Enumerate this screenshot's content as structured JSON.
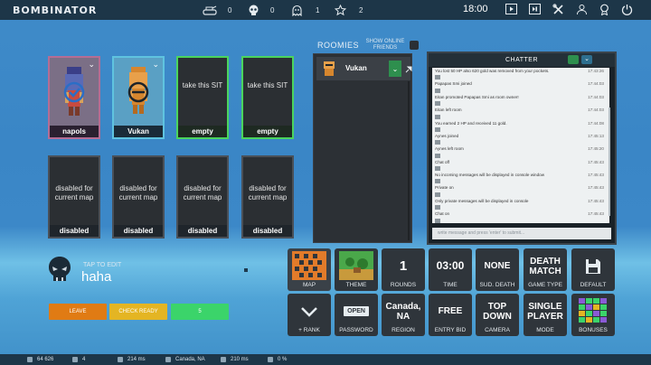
{
  "topbar": {
    "logo": "BOMBINATOR",
    "stats": [
      {
        "icon": "tank-icon",
        "value": "0"
      },
      {
        "icon": "skull-icon",
        "value": "0"
      },
      {
        "icon": "ghost-icon",
        "value": "1"
      },
      {
        "icon": "star-icon",
        "value": "2"
      }
    ],
    "time": "18:00",
    "buttons": [
      "video-icon",
      "replay-icon",
      "tools-icon",
      "users-icon",
      "trophy-icon",
      "power-icon"
    ]
  },
  "slots_top": [
    {
      "name": "napols",
      "style": "pink",
      "has_avatar": true
    },
    {
      "name": "Vukan",
      "style": "blue",
      "has_avatar": true
    },
    {
      "name": "empty",
      "style": "green",
      "text": "take this SIT"
    },
    {
      "name": "empty",
      "style": "green",
      "text": "take this SIT"
    }
  ],
  "slots_bottom": [
    {
      "name": "disabled",
      "text": "disabled for current map"
    },
    {
      "name": "disabled",
      "text": "disabled for current map"
    },
    {
      "name": "disabled",
      "text": "disabled for current map"
    },
    {
      "name": "disabled",
      "text": "disabled for current map"
    }
  ],
  "roomies": {
    "title": "ROOMIES",
    "show_online": "SHOW ONLINE FRIENDS",
    "entries": [
      {
        "name": "Vukan"
      }
    ]
  },
  "chatter": {
    "title": "CHATTER",
    "input_placeholder": "write message and press 'enter' to submit...",
    "lines": [
      {
        "text": "You lost 50 HP also 620 gold was removed from your pockets.",
        "time": "17:43:26"
      },
      {
        "text": "Papapas Smi joined",
        "time": "17:44:03"
      },
      {
        "text": "Eitan promoted Papapas Smi as room owner!",
        "time": "17:44:03"
      },
      {
        "text": "Eitan left room",
        "time": "17:44:03"
      },
      {
        "text": "You earned 2 HP and received 11 gold.",
        "time": "17:44:08"
      },
      {
        "text": "Aynes joined",
        "time": "17:45:13"
      },
      {
        "text": "Aynes left room",
        "time": "17:45:20"
      },
      {
        "text": "Chat off",
        "time": "17:45:43"
      },
      {
        "text": "No incoming messages will be displayed in console window",
        "time": "17:45:43"
      },
      {
        "text": "Private on",
        "time": "17:45:43"
      },
      {
        "text": "Only private messages will be displayed in console",
        "time": "17:45:43"
      },
      {
        "text": "Chat on",
        "time": "17:45:43"
      },
      {
        "text": "Private and room messages will be displayed in console",
        "time": "17:45:43"
      },
      {
        "text": "Chat off",
        "time": "17:45:43"
      },
      {
        "text": "No incoming messages will be displayed in console window",
        "time": "17:46:41"
      },
      {
        "text": "napols",
        "time": "17:59:25"
      },
      {
        "text": "i won't game!!!",
        "time": "17:59:25"
      },
      {
        "text": "Vukan joined",
        "time": "18:00:34"
      }
    ]
  },
  "user": {
    "tap_to_edit": "TAP TO EDIT",
    "name": "haha"
  },
  "actions": {
    "leave": "LEAVE",
    "check_ready": "CHECK READY",
    "count": "5"
  },
  "settings": [
    {
      "id": "map",
      "value": "",
      "label": "MAP"
    },
    {
      "id": "theme",
      "value": "",
      "label": "THEME"
    },
    {
      "id": "rounds",
      "value": "1",
      "label": "ROUNDS"
    },
    {
      "id": "time",
      "value": "03:00",
      "label": "TIME"
    },
    {
      "id": "sud-death",
      "value": "NONE",
      "label": "SUD. DEATH"
    },
    {
      "id": "game-type",
      "value": "DEATH MATCH",
      "label": "GAME TYPE"
    },
    {
      "id": "default",
      "value": "",
      "label": "DEFAULT"
    },
    {
      "id": "rank",
      "value": "",
      "label": "+ RANK"
    },
    {
      "id": "password",
      "value": "OPEN",
      "label": "PASSWORD"
    },
    {
      "id": "region",
      "value": "Canada, NA",
      "label": "REGION"
    },
    {
      "id": "entry-bid",
      "value": "FREE",
      "label": "ENTRY BID"
    },
    {
      "id": "camera",
      "value": "TOP DOWN",
      "label": "CAMERA"
    },
    {
      "id": "mode",
      "value": "SINGLE PLAYER",
      "label": "MODE"
    },
    {
      "id": "bonuses",
      "value": "",
      "label": "BONUSES"
    }
  ],
  "statusbar": [
    {
      "icon": "users-icon",
      "value": "64 626"
    },
    {
      "icon": "room-icon",
      "value": "4"
    },
    {
      "icon": "ping-icon",
      "value": "214 ms"
    },
    {
      "icon": "region-icon",
      "value": "Canada, NA"
    },
    {
      "icon": "ping2-icon",
      "value": "210 ms"
    },
    {
      "icon": "loss-icon",
      "value": "0 %"
    }
  ]
}
